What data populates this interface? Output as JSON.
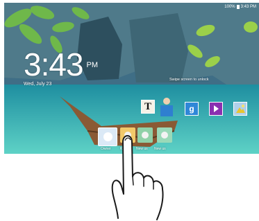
{
  "status_bar": {
    "battery": "100%",
    "time": "3:43 PM"
  },
  "lock_screen": {
    "clock_time": "3:43",
    "clock_ampm": "PM",
    "date": "Wed, July 23",
    "swipe_hint": "Swipe screen to unlock"
  },
  "widgets": [
    {
      "name": "text-app",
      "glyph": "T"
    },
    {
      "name": "google-search",
      "glyph": "g"
    },
    {
      "name": "play-video",
      "glyph": "play-icon"
    },
    {
      "name": "photo-gallery",
      "glyph": "photo-icon"
    }
  ],
  "users": [
    {
      "label": "Owner"
    },
    {
      "label": "K"
    },
    {
      "label": "New us"
    },
    {
      "label": "New us"
    }
  ]
}
